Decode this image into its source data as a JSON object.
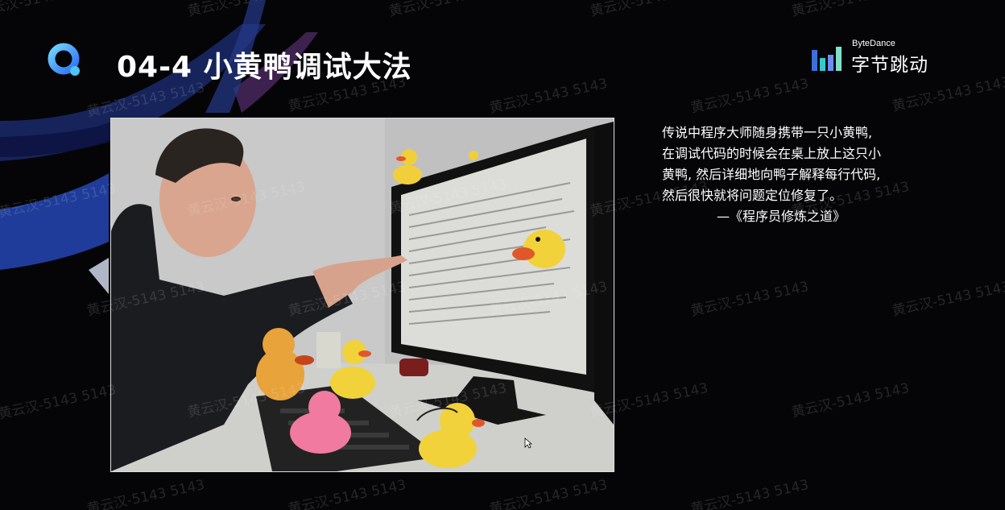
{
  "slide": {
    "title": "04-4 小黄鸭调试大法",
    "brand_en": "ByteDance",
    "brand_cn": "字节跳动",
    "colors": {
      "background": "#050507",
      "text": "#ffffff",
      "accent_blue": "#2e6df5",
      "accent_cyan": "#4fc3f7"
    }
  },
  "photo": {
    "icon": "rubber-duck-debugging-photo"
  },
  "quote": {
    "lines": [
      "传说中程序大师随身携带一只小黄鸭,",
      "在调试代码的时候会在桌上放上这只小",
      "黄鸭, 然后详细地向鸭子解释每行代码,",
      "然后很快就将问题定位修复了。"
    ],
    "source": "—《程序员修炼之道》"
  },
  "watermark": {
    "text": "黄云汉-5143 5143"
  }
}
